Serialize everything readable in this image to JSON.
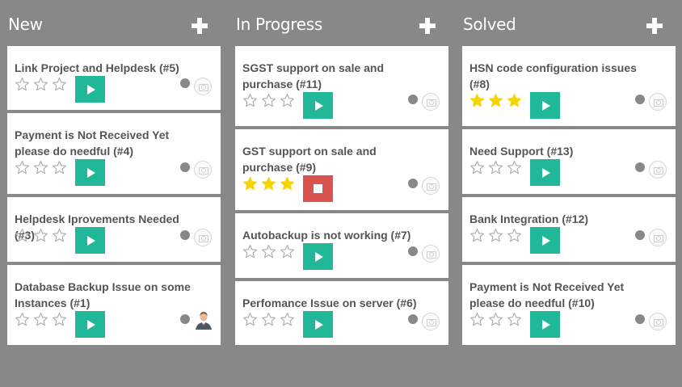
{
  "colors": {
    "background": "#888888",
    "card": "#ffffff",
    "accent_play": "#21b799",
    "stop": "#d9534f",
    "star_filled": "#f5d400",
    "star_empty": "#aaaaaa",
    "title_text": "#555555"
  },
  "icons": {
    "add": "plus-icon",
    "play": "play-icon",
    "stop": "stop-icon",
    "star": "star-icon",
    "status": "status-dot",
    "avatar": "camera-placeholder-icon"
  },
  "columns": [
    {
      "title": "New",
      "cards": [
        {
          "title": "Link Project and Helpdesk (#5)",
          "rating": 0,
          "timer": "play",
          "avatar": "placeholder"
        },
        {
          "title": "Payment is Not Received Yet please do needful (#4)",
          "rating": 0,
          "timer": "play",
          "avatar": "placeholder"
        },
        {
          "title": "Helpdesk Iprovements Needed (#3)",
          "rating": 0,
          "timer": "play",
          "avatar": "placeholder"
        },
        {
          "title": "Database Backup Issue on some Instances (#1)",
          "rating": 0,
          "timer": "play",
          "avatar": "photo"
        }
      ]
    },
    {
      "title": "In Progress",
      "cards": [
        {
          "title": "SGST support on sale and purchase (#11)",
          "rating": 0,
          "timer": "play",
          "avatar": "placeholder"
        },
        {
          "title": "GST support on sale and purchase (#9)",
          "rating": 3,
          "timer": "stop",
          "avatar": "placeholder"
        },
        {
          "title": "Autobackup is not working (#7)",
          "rating": 0,
          "timer": "play",
          "avatar": "placeholder"
        },
        {
          "title": "Perfomance Issue on server (#6)",
          "rating": 0,
          "timer": "play",
          "avatar": "placeholder"
        }
      ]
    },
    {
      "title": "Solved",
      "cards": [
        {
          "title": "HSN code configuration issues (#8)",
          "rating": 3,
          "timer": "play",
          "avatar": "placeholder"
        },
        {
          "title": "Need Support (#13)",
          "rating": 0,
          "timer": "play",
          "avatar": "placeholder"
        },
        {
          "title": "Bank Integration (#12)",
          "rating": 0,
          "timer": "play",
          "avatar": "placeholder"
        },
        {
          "title": "Payment is Not Received Yet please do needful (#10)",
          "rating": 0,
          "timer": "play",
          "avatar": "placeholder"
        }
      ]
    }
  ]
}
